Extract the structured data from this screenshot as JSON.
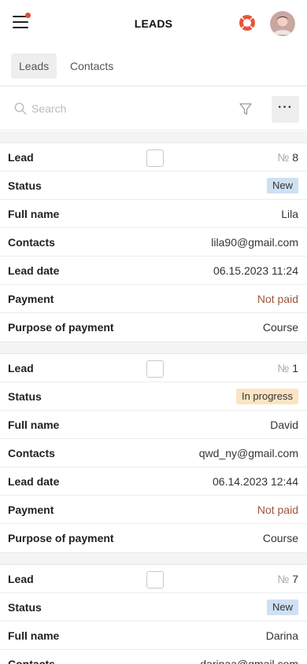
{
  "header": {
    "title": "LEADS",
    "menu_icon": "hamburger-menu-icon",
    "notification_dot_color": "#e64a2e",
    "help_icon": "lifebuoy-icon",
    "avatar_icon": "user-avatar"
  },
  "tabs": [
    {
      "label": "Leads",
      "active": true
    },
    {
      "label": "Contacts",
      "active": false
    }
  ],
  "search": {
    "placeholder": "Search",
    "filter_icon": "filter-icon",
    "more_label": "···"
  },
  "field_labels": {
    "lead": "Lead",
    "status": "Status",
    "full_name": "Full name",
    "contacts": "Contacts",
    "lead_date": "Lead date",
    "payment": "Payment",
    "purpose": "Purpose of payment"
  },
  "number_prefix": "№",
  "colors": {
    "status_new": "#cfe0f3",
    "status_in_progress": "#fbe4c4",
    "not_paid": "#a0563c"
  },
  "leads": [
    {
      "number": "8",
      "status": "New",
      "status_type": "new",
      "full_name": "Lila",
      "contacts": "lila90@gmail.com",
      "lead_date": "06.15.2023 11:24",
      "payment": "Not paid",
      "purpose": "Course"
    },
    {
      "number": "1",
      "status": "In progress",
      "status_type": "progress",
      "full_name": "David",
      "contacts": "qwd_ny@gmail.com",
      "lead_date": "06.14.2023 12:44",
      "payment": "Not paid",
      "purpose": "Course"
    },
    {
      "number": "7",
      "status": "New",
      "status_type": "new",
      "full_name": "Darina",
      "contacts": "darinaa@gmail.com",
      "lead_date": "",
      "payment": "",
      "purpose": ""
    }
  ]
}
